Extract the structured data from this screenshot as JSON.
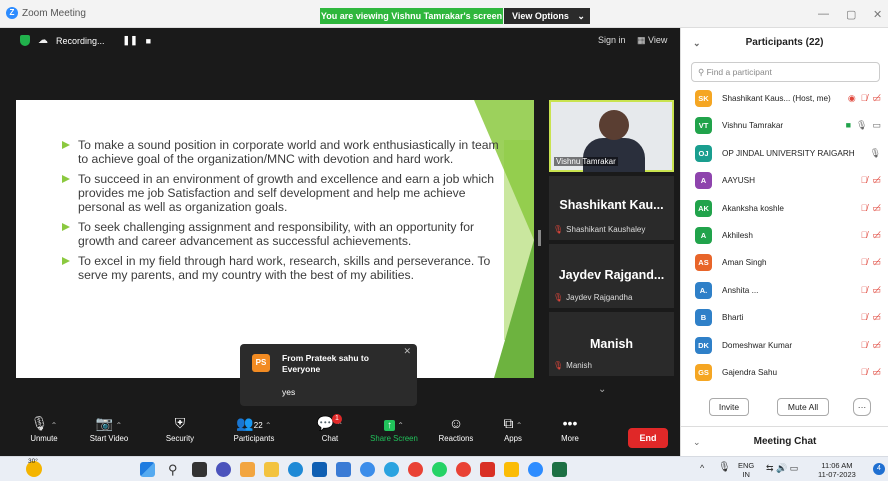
{
  "window": {
    "title": "Zoom Meeting",
    "app_icon": "Z"
  },
  "banner": {
    "text": "You are viewing Vishnu Tamrakar's screen",
    "view_options": "View Options",
    "color": "#2fb73d"
  },
  "window_controls": {
    "minimize": "—",
    "maximize": "▢",
    "close": "✕"
  },
  "recording": {
    "label": "Recording..."
  },
  "top_controls": {
    "signin": "Sign in",
    "view": "View"
  },
  "slide": {
    "bullets": [
      "To make a sound position in corporate world and work enthusiastically in team to achieve goal of the organization/MNC with devotion and hard work.",
      "To succeed in an environment of growth and excellence and earn a job which provides me job Satisfaction and self development and help me achieve personal as well as organization goals.",
      "To seek challenging assignment and responsibility, with an opportunity for growth and career advancement as successful achievements.",
      "To excel in my field through hard work, research, skills and perseverance. To serve my parents, and my country with the best of my abilities."
    ],
    "accent": "#8bc93f"
  },
  "thumbnails": [
    {
      "name": "Vishnu Tamrakar"
    },
    {
      "display": "Shashikant Kau...",
      "name": "Shashikant Kaushaley"
    },
    {
      "display": "Jaydev Rajgand...",
      "name": "Jaydev Rajgandha"
    },
    {
      "display": "Manish",
      "name": "Manish"
    }
  ],
  "chat_popup": {
    "initials": "PS",
    "from": "From Prateek sahu to Everyone",
    "message": "yes"
  },
  "toolbar": {
    "unmute": "Unmute",
    "start_video": "Start Video",
    "security": "Security",
    "participants": "Participants",
    "participants_count": "22",
    "chat": "Chat",
    "chat_badge": "1",
    "share_screen": "Share Screen",
    "reactions": "Reactions",
    "apps": "Apps",
    "more": "More",
    "end": "End"
  },
  "panel": {
    "title": "Participants (22)",
    "search_placeholder": "Find a participant",
    "participants": [
      {
        "initials": "SK",
        "name": "Shashikant Kaus... (Host, me)",
        "color": "#f5a623",
        "icons": "rec-mic-cam-off"
      },
      {
        "initials": "VT",
        "name": "Vishnu Tamrakar",
        "color": "#21a34b",
        "icons": "share-mic-cam"
      },
      {
        "initials": "OJ",
        "name": "OP JINDAL UNIVERSITY RAIGARH",
        "color": "#1a9e8f",
        "icons": "mic"
      },
      {
        "initials": "A",
        "name": "AAYUSH",
        "color": "#8e44ad",
        "icons": "off"
      },
      {
        "initials": "AK",
        "name": "Akanksha koshle",
        "color": "#21a34b",
        "icons": "off"
      },
      {
        "initials": "A",
        "name": "Akhilesh",
        "color": "#21a34b",
        "icons": "off"
      },
      {
        "initials": "AS",
        "name": "Aman Singh",
        "color": "#e8652a",
        "icons": "off"
      },
      {
        "initials": "A.",
        "name": "Anshita ...",
        "color": "#2f80c8",
        "icons": "off"
      },
      {
        "initials": "B",
        "name": "Bharti",
        "color": "#2f80c8",
        "icons": "off"
      },
      {
        "initials": "DK",
        "name": "Domeshwar Kumar",
        "color": "#2f80c8",
        "icons": "off"
      },
      {
        "initials": "GS",
        "name": "Gajendra Sahu",
        "color": "#f5a623",
        "icons": "off"
      }
    ],
    "invite": "Invite",
    "mute_all": "Mute All",
    "more": "···",
    "meeting_chat": "Meeting Chat"
  },
  "taskbar": {
    "weather": "30°",
    "lang": "ENG",
    "region": "IN",
    "time": "11:06 AM",
    "date": "11-07-2023",
    "notif": "4"
  }
}
